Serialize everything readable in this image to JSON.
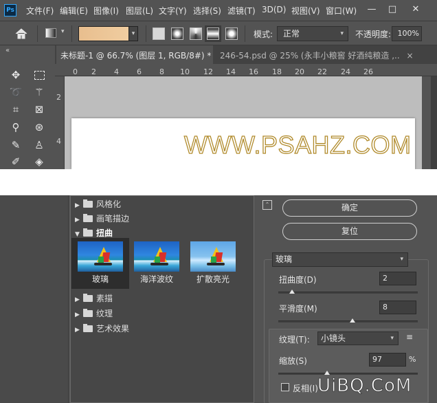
{
  "menubar": {
    "logo": "Ps",
    "items": [
      "文件(F)",
      "编辑(E)",
      "图像(I)",
      "图层(L)",
      "文字(Y)",
      "选择(S)",
      "滤镜(T)",
      "3D(D)",
      "视图(V)",
      "窗口(W)"
    ],
    "controls": [
      "—",
      "□",
      "✕"
    ]
  },
  "options": {
    "mode_label": "模式:",
    "mode_value": "正常",
    "opacity_label": "不透明度:",
    "opacity_value": "100%",
    "gradient_colors": [
      "#e8be8e",
      "#f0cda0"
    ]
  },
  "tabs": {
    "active": "未标题-1 @ 66.7% (图层 1, RGB/8#) *",
    "active_close": "×",
    "inactive": "246-54.psd @ 25% (永丰小粮窖 好酒纯粮造 ,..",
    "inactive_close": "×"
  },
  "rulers": {
    "top": [
      "0",
      "2",
      "4",
      "6",
      "8",
      "10",
      "12",
      "14",
      "16",
      "18",
      "20",
      "22",
      "24",
      "26"
    ],
    "left": [
      "2",
      "4"
    ]
  },
  "canvas": {
    "text": "WWW.PSAHZ.COM",
    "stroke_color": "#b08a2a"
  },
  "filter_gallery": {
    "categories_top": [
      {
        "label": "风格化",
        "open": false
      },
      {
        "label": "画笔描边",
        "open": false
      },
      {
        "label": "扭曲",
        "open": true
      }
    ],
    "thumbnails": [
      "玻璃",
      "海洋波纹",
      "扩散亮光"
    ],
    "categories_bottom": [
      {
        "label": "素描",
        "open": false
      },
      {
        "label": "纹理",
        "open": false
      },
      {
        "label": "艺术效果",
        "open": false
      }
    ],
    "ok_label": "确定",
    "reset_label": "复位",
    "filter_selected": "玻璃",
    "params": {
      "distortion_label": "扭曲度(D)",
      "distortion_value": "2",
      "distortion_level": 0.1,
      "smoothness_label": "平滑度(M)",
      "smoothness_value": "8",
      "smoothness_level": 0.53,
      "texture_label": "纹理(T):",
      "texture_value": "小镜头",
      "texture_menu": "≡",
      "scale_label": "缩放(S)",
      "scale_value": "97",
      "scale_unit": "%",
      "scale_level": 0.35,
      "invert_label": "反相(I)"
    }
  },
  "watermark": "UiBQ.CoM"
}
